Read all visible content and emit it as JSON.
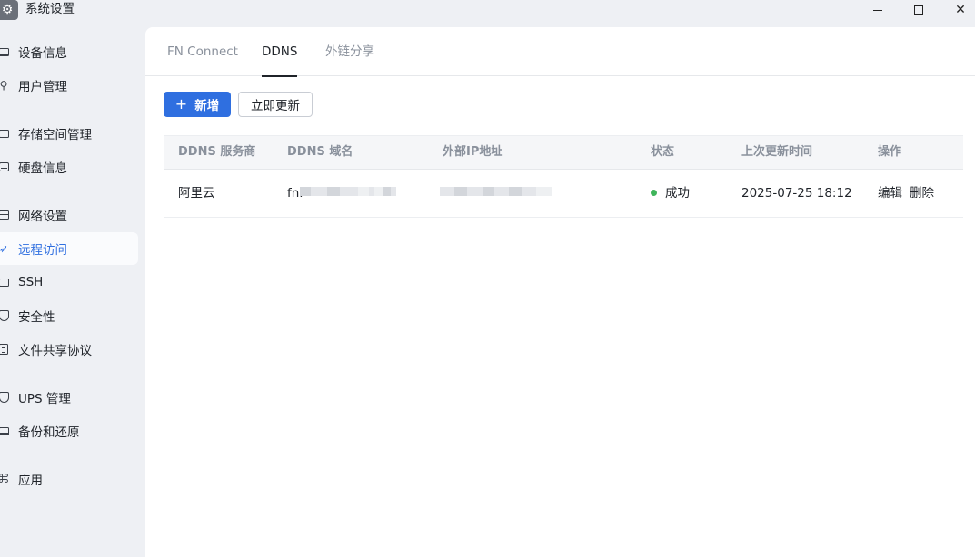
{
  "window": {
    "title": "系统设置",
    "app_icon": "gear-icon",
    "controls": [
      "minimize-icon",
      "maximize-icon",
      "close-icon"
    ]
  },
  "sidebar": {
    "items": [
      {
        "label": "设备信息",
        "icon": "device-info-icon"
      },
      {
        "label": "用户管理",
        "icon": "user-key-icon"
      },
      {
        "label": "存储空间管理",
        "icon": "storage-icon"
      },
      {
        "label": "硬盘信息",
        "icon": "hard-disk-icon"
      },
      {
        "label": "网络设置",
        "icon": "network-icon"
      },
      {
        "label": "远程访问",
        "icon": "send-arrow-icon",
        "active": true
      },
      {
        "label": "SSH",
        "icon": "terminal-icon"
      },
      {
        "label": "安全性",
        "icon": "shield-check-icon"
      },
      {
        "label": "文件共享协议",
        "icon": "file-share-icon"
      },
      {
        "label": "UPS 管理",
        "icon": "shield-icon"
      },
      {
        "label": "备份和还原",
        "icon": "backup-icon"
      },
      {
        "label": "应用",
        "icon": "apps-command-icon"
      }
    ]
  },
  "tabs": [
    {
      "label": "FN Connect"
    },
    {
      "label": "DDNS",
      "active": true
    },
    {
      "label": "外链分享"
    }
  ],
  "toolbar": {
    "add_label": "新增",
    "update_label": "立即更新"
  },
  "table": {
    "headers": [
      "DDNS 服务商",
      "DDNS 域名",
      "外部IP地址",
      "状态",
      "上次更新时间",
      "操作"
    ],
    "rows": [
      {
        "provider": "阿里云",
        "domain_prefix": "fn.",
        "status": "成功",
        "status_color": "#3fb55b",
        "updated": "2025-07-25 18:12",
        "actions": [
          "编辑",
          "删除"
        ]
      }
    ]
  },
  "colors": {
    "accent": "#2f6fe0",
    "success": "#3fb55b"
  }
}
